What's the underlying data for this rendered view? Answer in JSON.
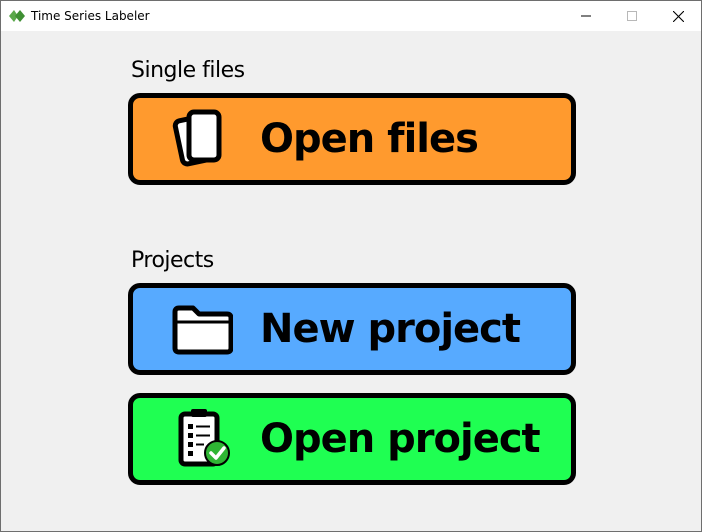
{
  "window": {
    "title": "Time Series Labeler",
    "app_icon": "diamond-tag-icon",
    "controls": [
      "minimize-icon",
      "maximize-icon",
      "close-icon"
    ]
  },
  "single_files": {
    "heading": "Single files",
    "open_files": {
      "label": "Open files",
      "icon": "files-icon",
      "color": "#ff9a2e"
    }
  },
  "projects": {
    "heading": "Projects",
    "new_project": {
      "label": "New project",
      "icon": "folder-icon",
      "color": "#57aaff"
    },
    "open_project": {
      "label": "Open project",
      "icon": "clipboard-check-icon",
      "color": "#1fff52"
    }
  }
}
